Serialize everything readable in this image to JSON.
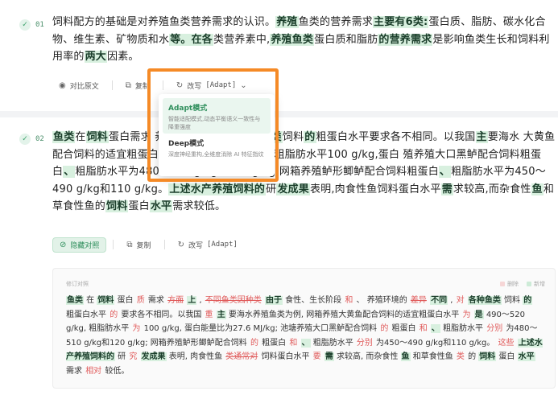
{
  "para1": {
    "num": "01",
    "segments": [
      {
        "t": "饲料配方的基础是对养殖鱼类营养需求的认识。"
      },
      {
        "t": "养殖",
        "hl": true
      },
      {
        "t": "鱼类的营养需求"
      },
      {
        "t": "主要有6类:",
        "hl": true
      },
      {
        "t": "蛋白质、脂肪、碳水化合物、维生素、矿物质和水"
      },
      {
        "t": "等。在各",
        "hl": true
      },
      {
        "t": "类营养素中,"
      },
      {
        "t": "养殖鱼类",
        "hl": true
      },
      {
        "t": "蛋白质和脂肪"
      },
      {
        "t": "的营养需求",
        "hl": true
      },
      {
        "t": "是影响鱼类生长和饲料利用率的"
      },
      {
        "t": "两大",
        "hl": true
      },
      {
        "t": "因素。"
      }
    ],
    "toolbar": {
      "compare": "对比原文",
      "copy": "复制",
      "rewrite": "改写",
      "mode": "[Adapt]"
    }
  },
  "dropdown": {
    "items": [
      {
        "title": "Adapt模式",
        "desc": "智能适配模式,动态平衡语义一致性与降重强度",
        "selected": true
      },
      {
        "title": "Deep模式",
        "desc": "深度神经重构,全维度消除 AI 特征指纹",
        "selected": false
      }
    ]
  },
  "para2": {
    "num": "02",
    "segments": [
      {
        "t": "鱼类",
        "hl": true
      },
      {
        "t": "在"
      },
      {
        "t": "饲料",
        "hl": true
      },
      {
        "t": "蛋白需求"
      },
      {
        "t": " ",
        "dim": true
      },
      {
        "t": "养殖环境的"
      },
      {
        "t": "不同,",
        "hl": true
      },
      {
        "t": "  "
      },
      {
        "t": "各种鱼类",
        "hl": true
      },
      {
        "t": "饲料"
      },
      {
        "t": "的",
        "hl": true
      },
      {
        "t": "粗蛋白水平要求各不相同。以我国"
      },
      {
        "t": "主",
        "hl": true
      },
      {
        "t": "要海水"
      },
      {
        "t": "      ",
        "dim": true
      },
      {
        "t": "大黄鱼配合饲料的适宜粗蛋白水平"
      },
      {
        "t": "是",
        "hl": true
      },
      {
        "t": "490～520 g/kg,粗脂肪水平100 g/kg,蛋白"
      },
      {
        "t": "             ",
        "dim": true
      },
      {
        "t": "殖养殖大口黑鲈配合饲料粗蛋白"
      },
      {
        "t": "、",
        "hl": true
      },
      {
        "t": "粗脂肪水平为480～510 g/kg和120 g/kg;网箱养殖鲈形鲫鲈配合饲料粗蛋白"
      },
      {
        "t": "、",
        "hl": true
      },
      {
        "t": "粗脂肪水平为450～490 g/kg和110 g/kg。"
      },
      {
        "t": "上述水产养殖饲料的",
        "hl": true
      },
      {
        "t": "研"
      },
      {
        "t": "发成果",
        "hl": true
      },
      {
        "t": "表明,肉食性鱼饲料蛋白水平"
      },
      {
        "t": "需",
        "hl": true
      },
      {
        "t": "求较高,而杂食性"
      },
      {
        "t": "鱼",
        "hl": true
      },
      {
        "t": "和草食性鱼的"
      },
      {
        "t": "饲料",
        "hl": true
      },
      {
        "t": "蛋白"
      },
      {
        "t": "水平",
        "hl": true
      },
      {
        "t": "需求较低。"
      }
    ],
    "toolbar": {
      "hide_compare": "隐藏对照",
      "copy": "复制",
      "rewrite": "改写",
      "mode": "[Adapt]"
    },
    "diff": {
      "label": "修订对照",
      "legend_del": "删除",
      "legend_ins": "新增",
      "segments": [
        {
          "t": "鱼类",
          "k": "ins"
        },
        {
          "t": " 在 "
        },
        {
          "t": "饲料",
          "k": "ins"
        },
        {
          "t": " 蛋白 "
        },
        {
          "t": "质",
          "k": "chg"
        },
        {
          "t": " 需求 "
        },
        {
          "t": "方面",
          "k": "del"
        },
        {
          "t": " "
        },
        {
          "t": "上",
          "k": "ins"
        },
        {
          "t": " , "
        },
        {
          "t": "不同鱼类因种类",
          "k": "del"
        },
        {
          "t": " "
        },
        {
          "t": "由于",
          "k": "ins"
        },
        {
          "t": " 食性、生长阶段 "
        },
        {
          "t": "和",
          "k": "chg"
        },
        {
          "t": " 、 养殖环境的 "
        },
        {
          "t": "差异",
          "k": "del"
        },
        {
          "t": " "
        },
        {
          "t": "不同",
          "k": "ins"
        },
        {
          "t": " , "
        },
        {
          "t": "对",
          "k": "chg"
        },
        {
          "t": " "
        },
        {
          "t": "各种鱼类",
          "k": "ins"
        },
        {
          "t": " 饲料 "
        },
        {
          "t": "的",
          "k": "ins"
        },
        {
          "t": " 粗蛋白水平 "
        },
        {
          "t": "的",
          "k": "chg"
        },
        {
          "t": " 要求各不相同。以我国 "
        },
        {
          "t": "重",
          "k": "chg"
        },
        {
          "t": " "
        },
        {
          "t": "主",
          "k": "ins"
        },
        {
          "t": " 要海水养殖鱼类为例, 网箱养殖大黄鱼配合饲料的适宜粗蛋白水平 "
        },
        {
          "t": "为",
          "k": "chg"
        },
        {
          "t": " "
        },
        {
          "t": "是",
          "k": "ins"
        },
        {
          "t": " 490～520 g/kg, 粗脂肪水平 "
        },
        {
          "t": "为",
          "k": "chg"
        },
        {
          "t": " 100 g/kg, 蛋白能量比为27.6 MJ/kg; 池塘养殖大口黑鲈配合饲料 "
        },
        {
          "t": "的",
          "k": "chg"
        },
        {
          "t": " 粗蛋白 "
        },
        {
          "t": "和",
          "k": "chg"
        },
        {
          "t": " "
        },
        {
          "t": "、",
          "k": "ins"
        },
        {
          "t": " 粗脂肪水平 "
        },
        {
          "t": "分别",
          "k": "chg"
        },
        {
          "t": " 为480～510 g/kg和120 g/kg; 网箱养殖鲈形鲫鲈配合饲料 "
        },
        {
          "t": "的",
          "k": "chg"
        },
        {
          "t": " 粗蛋白 "
        },
        {
          "t": "和",
          "k": "chg"
        },
        {
          "t": " "
        },
        {
          "t": "、",
          "k": "ins"
        },
        {
          "t": " 粗脂肪水平 "
        },
        {
          "t": "分别",
          "k": "chg"
        },
        {
          "t": " 为450～490 g/kg和110 g/kg。 "
        },
        {
          "t": "这些",
          "k": "chg"
        },
        {
          "t": " "
        },
        {
          "t": "上述水产养殖饲料的",
          "k": "ins"
        },
        {
          "t": " 研 "
        },
        {
          "t": "究",
          "k": "chg"
        },
        {
          "t": " "
        },
        {
          "t": "发成果",
          "k": "ins"
        },
        {
          "t": " 表明, 肉食性鱼 "
        },
        {
          "t": "类通常对",
          "k": "del"
        },
        {
          "t": " 饲料蛋白水平 "
        },
        {
          "t": "要",
          "k": "chg"
        },
        {
          "t": " "
        },
        {
          "t": "需",
          "k": "ins"
        },
        {
          "t": " 求较高, 而杂食性 "
        },
        {
          "t": "鱼",
          "k": "ins"
        },
        {
          "t": " 和草食性鱼 "
        },
        {
          "t": "类",
          "k": "chg"
        },
        {
          "t": " 的 "
        },
        {
          "t": "饲料",
          "k": "ins"
        },
        {
          "t": " 蛋白 "
        },
        {
          "t": "水平",
          "k": "ins"
        },
        {
          "t": " 需求 "
        },
        {
          "t": "相对",
          "k": "chg"
        },
        {
          "t": " 较低。"
        }
      ]
    }
  },
  "colors": {
    "accent": "#2f8f5c",
    "highlight_bg": "#d8f0df",
    "annotation_border": "#f58a26",
    "deletion": "#e05a5a"
  }
}
